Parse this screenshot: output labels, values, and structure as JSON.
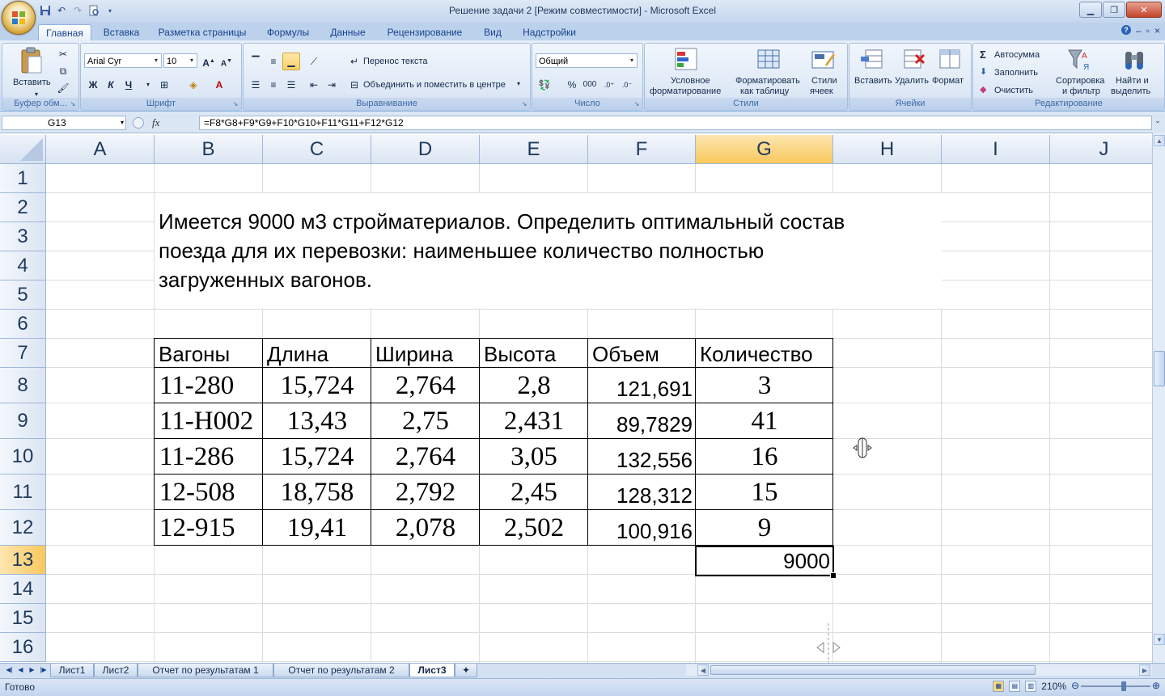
{
  "window": {
    "title": "Решение задачи 2  [Режим совместимости] - Microsoft Excel"
  },
  "quick_access": [
    "save-icon",
    "undo-icon",
    "redo-icon",
    "print-preview-icon",
    "customize-icon"
  ],
  "ribbon_tabs": [
    "Главная",
    "Вставка",
    "Разметка страницы",
    "Формулы",
    "Данные",
    "Рецензирование",
    "Вид",
    "Надстройки"
  ],
  "active_tab": "Главная",
  "ribbon": {
    "clipboard": {
      "paste": "Вставить",
      "label": "Буфер обм..."
    },
    "font": {
      "name": "Arial Cyr",
      "size": "10",
      "bold": "Ж",
      "italic": "К",
      "underline": "Ч",
      "label": "Шрифт"
    },
    "alignment": {
      "wrap": "Перенос текста",
      "merge": "Объединить и поместить в центре",
      "label": "Выравнивание"
    },
    "number": {
      "format": "Общий",
      "percent": "%",
      "thousands": "000",
      "label": "Число"
    },
    "styles": {
      "conditional_1": "Условное",
      "conditional_2": "форматирование",
      "table_1": "Форматировать",
      "table_2": "как таблицу",
      "cell_1": "Стили",
      "cell_2": "ячеек",
      "label": "Стили"
    },
    "cells": {
      "insert": "Вставить",
      "delete": "Удалить",
      "format": "Формат",
      "label": "Ячейки"
    },
    "editing": {
      "autosum": "Автосумма",
      "fill": "Заполнить",
      "clear": "Очистить",
      "sort_1": "Сортировка",
      "sort_2": "и фильтр",
      "find_1": "Найти и",
      "find_2": "выделить",
      "label": "Редактирование"
    }
  },
  "formula_bar": {
    "name_box": "G13",
    "fx": "fx",
    "formula": "=F8*G8+F9*G9+F10*G10+F11*G11+F12*G12"
  },
  "columns": [
    "A",
    "B",
    "C",
    "D",
    "E",
    "F",
    "G",
    "H",
    "I",
    "J"
  ],
  "selected_column": "G",
  "rows": [
    "1",
    "2",
    "3",
    "4",
    "5",
    "6",
    "7",
    "8",
    "9",
    "10",
    "11",
    "12",
    "13",
    "14",
    "15",
    "16"
  ],
  "selected_row": "13",
  "task_text": {
    "line1": "Имеется 9000 м3 стройматериалов. Определить оптимальный состав",
    "line2": "поезда для их перевозки: наименьшее количество полностью",
    "line3": "загруженных вагонов."
  },
  "table": {
    "headers": [
      "Вагоны",
      "Длина",
      "Ширина",
      "Высота",
      "Объем",
      "Количество"
    ],
    "rows": [
      [
        "11-280",
        "15,724",
        "2,764",
        "2,8",
        "121,691",
        "3"
      ],
      [
        "11-Н002",
        "13,43",
        "2,75",
        "2,431",
        "89,7829",
        "41"
      ],
      [
        "11-286",
        "15,724",
        "2,764",
        "3,05",
        "132,556",
        "16"
      ],
      [
        "12-508",
        "18,758",
        "2,792",
        "2,45",
        "128,312",
        "15"
      ],
      [
        "12-915",
        "19,41",
        "2,078",
        "2,502",
        "100,916",
        "9"
      ]
    ]
  },
  "result_cell": "9000",
  "sheet_tabs": [
    "Лист1",
    "Лист2",
    "Отчет по результатам 1",
    "Отчет по результатам 2",
    "Лист3"
  ],
  "active_sheet": "Лист3",
  "status": {
    "ready": "Готово",
    "zoom": "210%",
    "zoom_level_fraction": 0.62
  }
}
